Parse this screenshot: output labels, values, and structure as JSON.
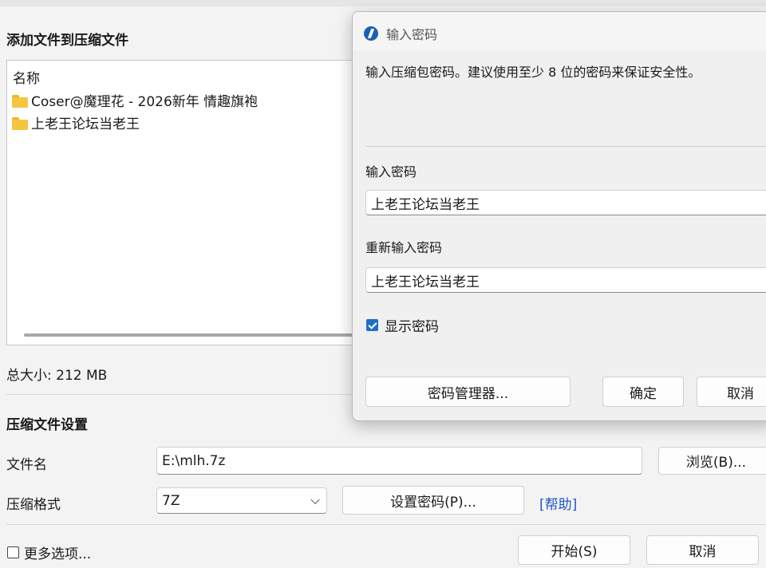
{
  "main": {
    "section_add_title": "添加文件到压缩文件",
    "list_header": "名称",
    "files": [
      {
        "name": "Coser@魔理花 - 2026新年 情趣旗袍",
        "icon": "folder-icon"
      },
      {
        "name": "上老王论坛当老王",
        "icon": "folder-icon"
      }
    ],
    "total_size": "总大小: 212 MB",
    "settings_title": "压缩文件设置",
    "filename_label": "文件名",
    "filename_value": "E:\\mlh.7z",
    "browse_button": "浏览(B)...",
    "format_label": "压缩格式",
    "format_value": "7Z",
    "set_password_button": "设置密码(P)...",
    "help_link": "[帮助]",
    "more_options_label": "更多选项...",
    "start_button": "开始(S)",
    "cancel_button": "取消"
  },
  "dialog": {
    "title": "输入密码",
    "description": "输入压缩包密码。建议使用至少 8 位的密码来保证安全性。",
    "password_label": "输入密码",
    "password_value": "上老王论坛当老王",
    "confirm_label": "重新输入密码",
    "confirm_value": "上老王论坛当老王",
    "show_password_label": "显示密码",
    "show_password_checked": true,
    "manager_button": "密码管理器...",
    "ok_button": "确定",
    "cancel_button": "取消"
  },
  "colors": {
    "accent": "#1f6fc5",
    "link": "#1f56c9",
    "folder": "#f5c542"
  }
}
